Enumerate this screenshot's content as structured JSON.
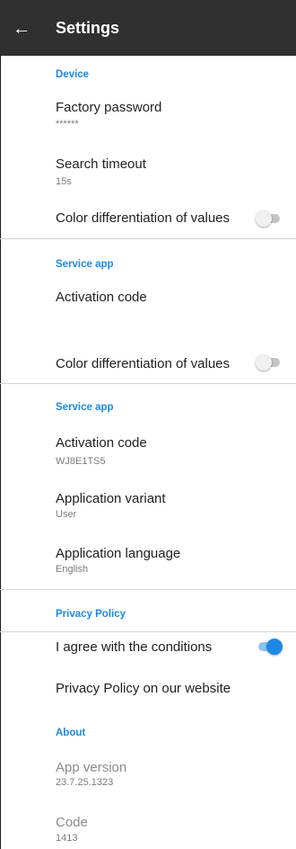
{
  "toolbar": {
    "back_icon": "arrow-left-icon",
    "title": "Settings"
  },
  "sections": {
    "device": {
      "header": "Device",
      "factory_password": {
        "title": "Factory password",
        "value": "******"
      },
      "search_timeout": {
        "title": "Search timeout",
        "value": "15s"
      },
      "color_diff": {
        "title": "Color differentiation of values",
        "enabled": false
      }
    },
    "service_app_a": {
      "header": "Service app",
      "activation_code": {
        "title": "Activation code"
      },
      "color_diff": {
        "title": "Color differentiation of values",
        "enabled": false
      }
    },
    "service_app_b": {
      "header": "Service app",
      "activation_code": {
        "title": "Activation code",
        "value": "WJ8E1TS5"
      },
      "app_variant": {
        "title": "Application variant",
        "value": "User"
      },
      "app_language": {
        "title": "Application language",
        "value": "English"
      }
    },
    "privacy": {
      "header": "Privacy Policy",
      "agree": {
        "title": "I agree with the conditions",
        "enabled": true
      },
      "website": {
        "title": "Privacy Policy on our website"
      }
    },
    "about": {
      "header": "About",
      "app_version": {
        "title": "App version",
        "value": "23.7.25.1323"
      },
      "code": {
        "title": "Code",
        "value": "1413"
      }
    }
  },
  "colors": {
    "accent": "#1e88e5",
    "toolbar": "#303030"
  }
}
